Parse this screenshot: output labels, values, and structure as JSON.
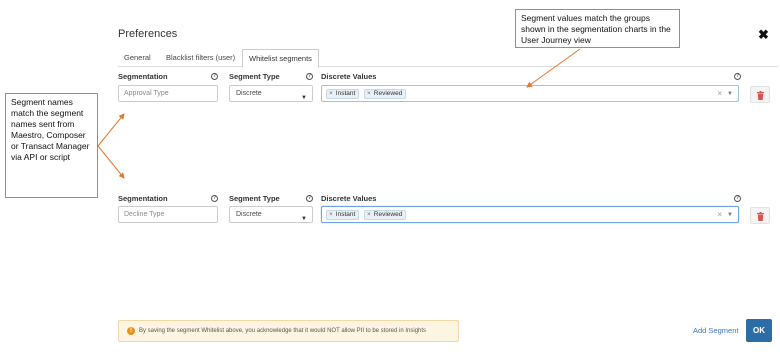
{
  "dialog": {
    "title": "Preferences",
    "close_glyph": "✖"
  },
  "tabs": [
    {
      "label": "General",
      "active": false
    },
    {
      "label": "Blacklist filters (user)",
      "active": false
    },
    {
      "label": "Whitelist segments",
      "active": true
    }
  ],
  "columns": {
    "segmentation": "Segmentation",
    "segment_type": "Segment Type",
    "discrete_values": "Discrete Values",
    "help_glyph": "?"
  },
  "rows": [
    {
      "segmentation_placeholder": "Approval Type",
      "segment_type": "Discrete",
      "values": [
        "Instant",
        "Reviewed"
      ],
      "chip_remove_glyph": "×",
      "clear_glyph": "×",
      "caret": "▼"
    },
    {
      "segmentation_placeholder": "Decline Type",
      "segment_type": "Discrete",
      "values": [
        "Instant",
        "Reviewed"
      ],
      "chip_remove_glyph": "×",
      "clear_glyph": "×",
      "caret": "▼"
    }
  ],
  "callouts": {
    "top": "Segment values match the groups shown in the segmentation charts in the User Journey view",
    "left": "Segment names match the segment names sent from Maestro, Composer or Transact Manager via API or script"
  },
  "notice": {
    "icon_glyph": "!",
    "text": "By saving the segment Whitelist above, you acknowledge that it would NOT allow PII to be stored in Insights"
  },
  "footer": {
    "add_segment": "Add Segment",
    "ok": "OK"
  },
  "colors": {
    "accent": "#2c6da6",
    "callout_border": "#e2772d",
    "delete_icon": "#d9534f",
    "notice_bg": "#fdf5e1"
  },
  "icons": [
    "close-icon",
    "help-icon",
    "chevron-down-icon",
    "trash-icon",
    "warning-icon"
  ]
}
